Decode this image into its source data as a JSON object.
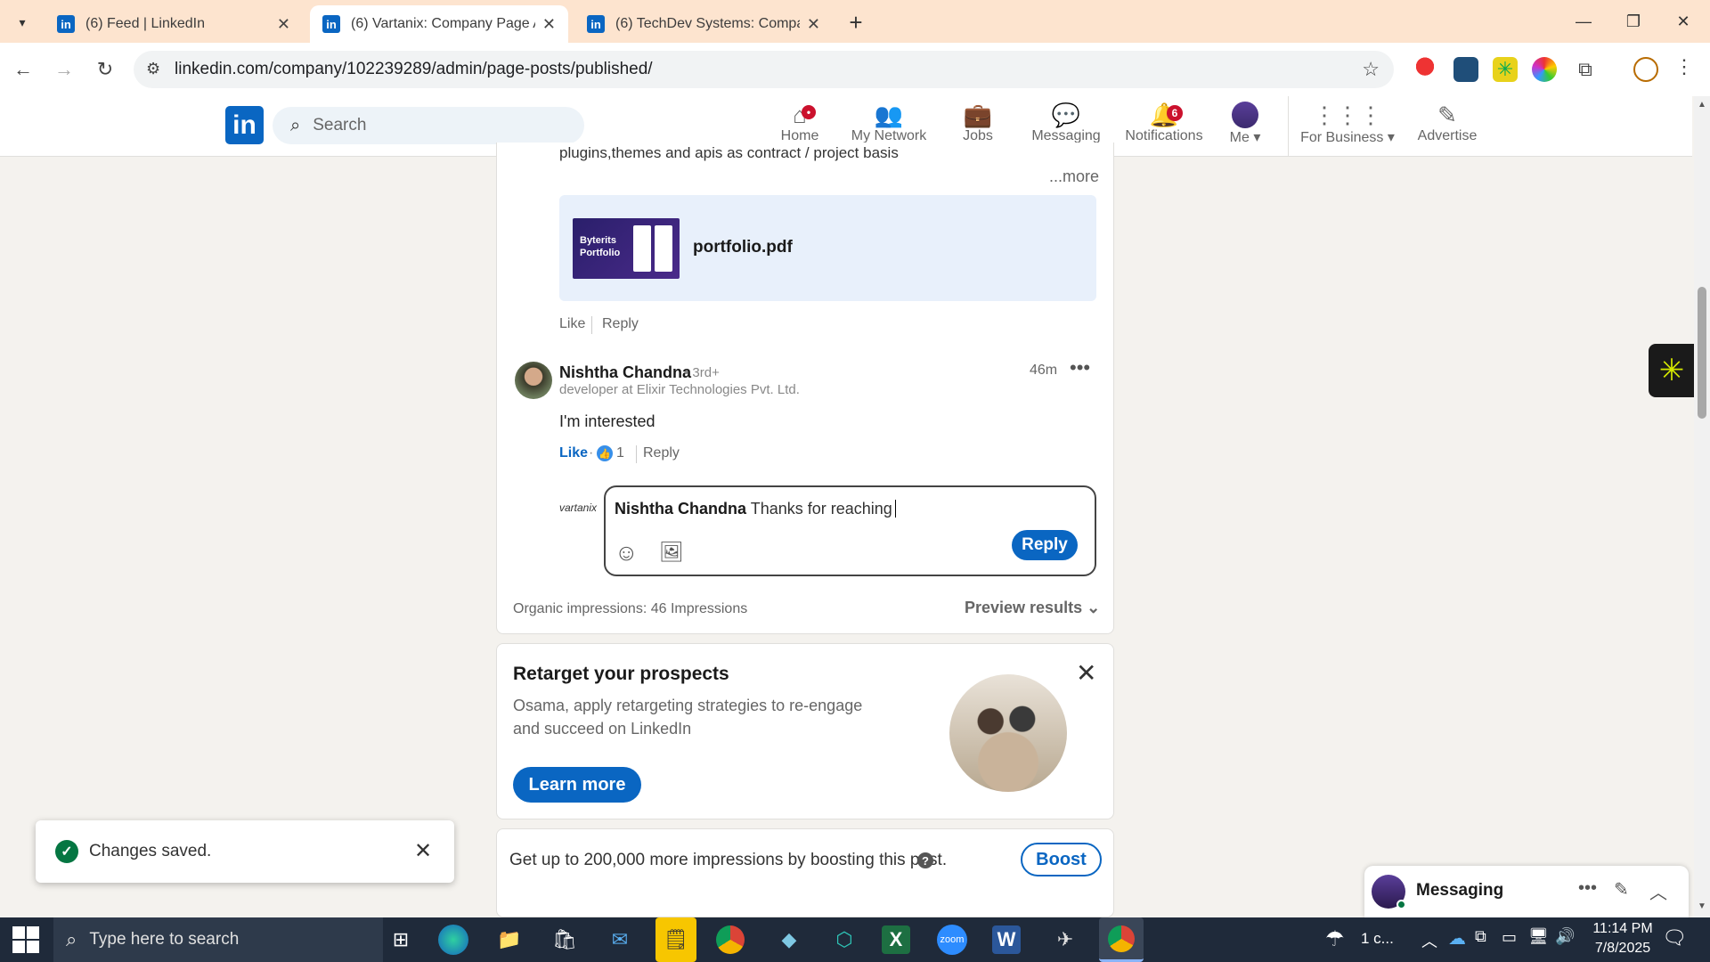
{
  "browser": {
    "tabs": [
      {
        "title": "(6) Feed | LinkedIn",
        "active": false
      },
      {
        "title": "(6) Vartanix: Company Page Ad",
        "active": true
      },
      {
        "title": "(6) TechDev Systems: Company",
        "active": false
      }
    ],
    "url": "linkedin.com/company/102239289/admin/page-posts/published/"
  },
  "li_nav": {
    "search_placeholder": "Search",
    "items": [
      {
        "label": "Home",
        "icon": "home-icon",
        "badge": ""
      },
      {
        "label": "My Network",
        "icon": "network-icon",
        "badge": ""
      },
      {
        "label": "Jobs",
        "icon": "briefcase-icon",
        "badge": ""
      },
      {
        "label": "Messaging",
        "icon": "messaging-icon",
        "badge": ""
      },
      {
        "label": "Notifications",
        "icon": "bell-icon",
        "badge": "6"
      },
      {
        "label": "Me",
        "icon": "avatar",
        "badge": ""
      },
      {
        "label": "For Business",
        "icon": "grid-icon",
        "badge": ""
      },
      {
        "label": "Advertise",
        "icon": "advertise-icon",
        "badge": ""
      }
    ]
  },
  "comment_top": {
    "snippet": "plugins,themes and apis as contract / project basis",
    "more": "...more",
    "attachment_name": "portfolio.pdf",
    "thumb_text": "Byterits Portfolio",
    "like": "Like",
    "reply": "Reply"
  },
  "comment": {
    "author": "Nishtha Chandna",
    "degree": "• 3rd+",
    "headline": "developer at Elixir Technologies Pvt. Ltd.",
    "time": "46m",
    "text": "I'm interested",
    "like": "Like",
    "reactions": "1",
    "reply": "Reply"
  },
  "reply_box": {
    "company_logo_text": "vartanix",
    "mention": "Nishtha Chandna",
    "text": "Thanks for reaching",
    "button": "Reply"
  },
  "post_footer": {
    "impressions": "Organic impressions: 46 Impressions",
    "preview": "Preview results"
  },
  "retarget": {
    "title": "Retarget your prospects",
    "body": "Osama, apply retargeting strategies to re-engage and succeed on LinkedIn",
    "cta": "Learn more"
  },
  "boost": {
    "text": "Get up to 200,000 more impressions by boosting this post.",
    "button": "Boost"
  },
  "toast": {
    "text": "Changes saved."
  },
  "messaging": {
    "label": "Messaging"
  },
  "taskbar": {
    "search_placeholder": "Type here to search",
    "weather": "1 c...",
    "time": "11:14 PM",
    "date": "7/8/2025"
  }
}
